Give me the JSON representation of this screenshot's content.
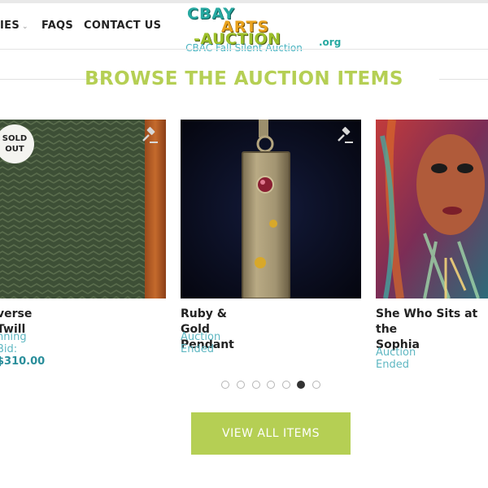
{
  "nav": {
    "items": [
      {
        "label": "IES"
      },
      {
        "label": "FAQS"
      },
      {
        "label": "CONTACT US"
      }
    ]
  },
  "logo": {
    "line1": "CBAY",
    "line2": "ARTS",
    "line3": "-AUCTION",
    "line4": ".org"
  },
  "subtitle": "CBAC Fall Silent Auction",
  "section": {
    "heading": "BROWSE THE AUCTION ITEMS"
  },
  "cards": [
    {
      "title": "verse Twill",
      "status_label": "nning Bid:",
      "status_value": "$310.00",
      "badge": [
        "SOLD",
        "OUT"
      ]
    },
    {
      "title": "Ruby & Gold Pendant",
      "status_label": "Auction Ended"
    },
    {
      "title_line1": "She Who Sits at the",
      "title_line2": "Sophia",
      "status_label": "Auction Ended"
    }
  ],
  "pagination": {
    "count": 7,
    "active_index": 5
  },
  "cta": {
    "label": "VIEW ALL ITEMS"
  },
  "colors": {
    "accent_green": "#b5cf54",
    "teal_text": "#5fb7c2",
    "teal_price": "#2a8e9b"
  },
  "icons": [
    "gavel-icon",
    "chevron-down-icon"
  ]
}
